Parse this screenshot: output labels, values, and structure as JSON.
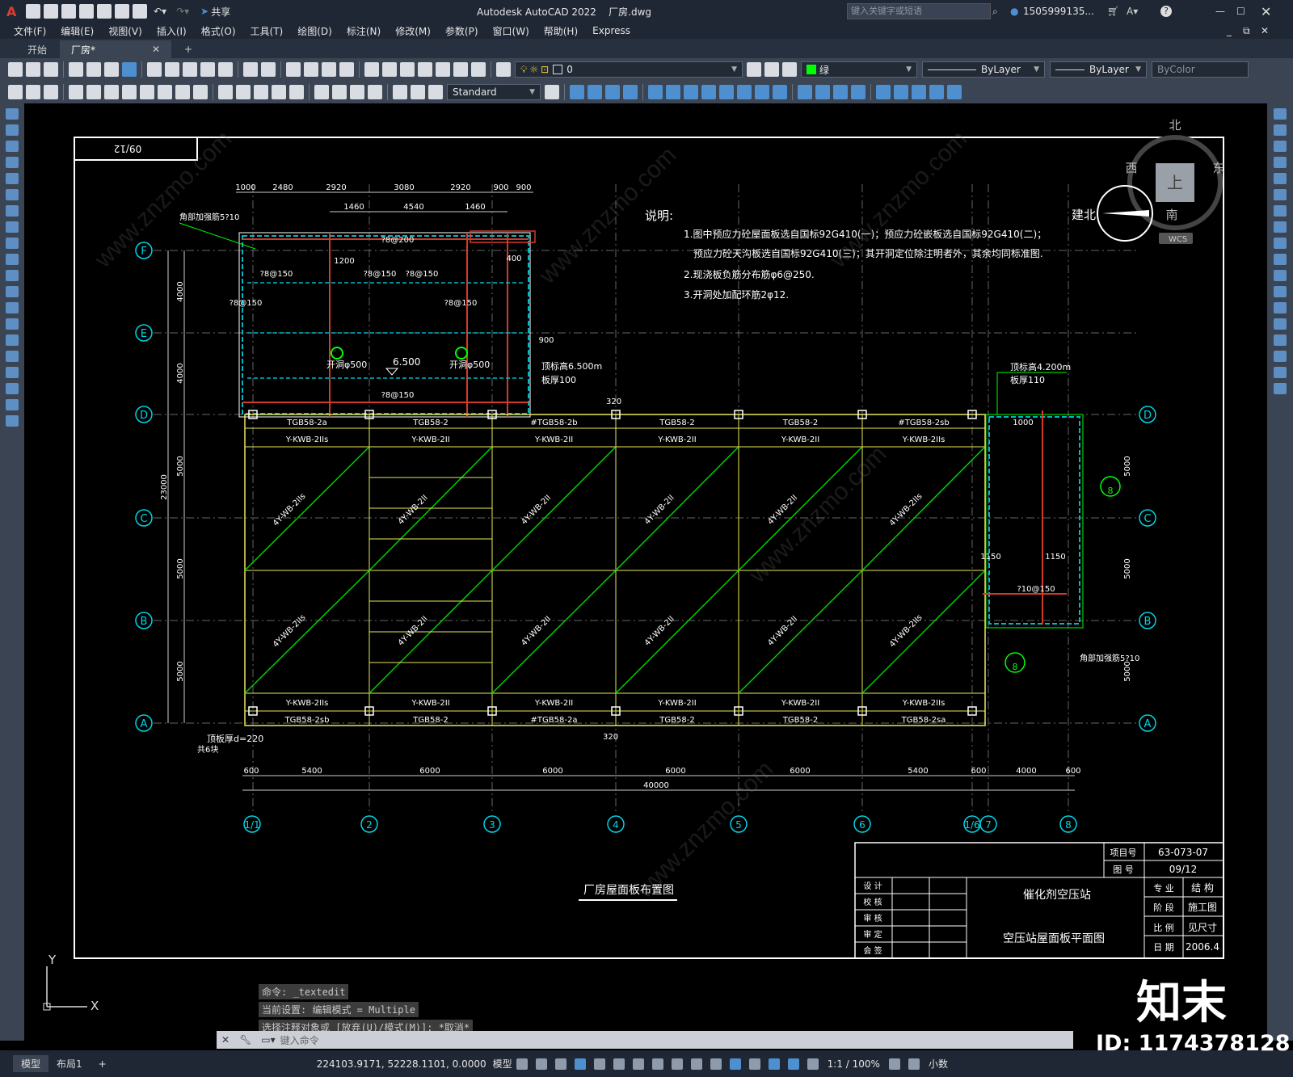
{
  "app": {
    "title": "Autodesk AutoCAD 2022    厂房.dwg",
    "share_label": "共享",
    "search_placeholder": "键入关键字或短语",
    "user": "1505999135...",
    "logo_letter": "A"
  },
  "menu": [
    "文件(F)",
    "编辑(E)",
    "视图(V)",
    "插入(I)",
    "格式(O)",
    "工具(T)",
    "绘图(D)",
    "标注(N)",
    "修改(M)",
    "参数(P)",
    "窗口(W)",
    "帮助(H)",
    "Express"
  ],
  "doc_tabs": [
    {
      "label": "开始",
      "active": false
    },
    {
      "label": "厂房*",
      "active": true
    }
  ],
  "toolbar": {
    "layer_value": "0",
    "color_value": "绿",
    "linetype_value": "ByLayer",
    "lineweight_value": "ByLayer",
    "plotstyle_value": "ByColor",
    "textstyle_value": "Standard"
  },
  "drawing": {
    "sheet_no": "09/12",
    "notes_title": "说明:",
    "notes": [
      "1.图中预应力砼屋面板选自国标92G410(一)；预应力砼嵌板选自国标92G410(二)；",
      "预应力砼天沟板选自国标92G410(三)；其开洞定位除注明者外，其余均同标准图.",
      "2.现浇板负筋分布筋φ6@250.",
      "3.开洞处加配环筋2φ12."
    ],
    "top_dims": [
      "1000",
      "2480",
      "2920",
      "3080",
      "2920",
      "900",
      "900"
    ],
    "top_dims2": [
      "1460",
      "4540",
      "1460"
    ],
    "bottom_dims": [
      "600",
      "5400",
      "6000",
      "6000",
      "6000",
      "6000",
      "5400",
      "600",
      "4000",
      "600"
    ],
    "total_dim": "40000",
    "row_axes": [
      "F",
      "E",
      "D",
      "C",
      "B",
      "A"
    ],
    "col_axes": [
      "1/1",
      "2",
      "3",
      "4",
      "5",
      "6",
      "1/6",
      "7",
      "8"
    ],
    "left_dims": [
      "4000",
      "4000",
      "5000",
      "5000",
      "5000"
    ],
    "left_total": "23000",
    "right_dims": [
      "5000",
      "5000",
      "5000"
    ],
    "top_row_labels": [
      "TGB58-2a",
      "TGB58-2",
      "#TGB58-2b",
      "TGB58-2",
      "TGB58-2",
      "#TGB58-2sb"
    ],
    "kwb_top_labels": [
      "Y-KWB-2IIs",
      "Y-KWB-2II",
      "Y-KWB-2II",
      "Y-KWB-2II",
      "Y-KWB-2II",
      "Y-KWB-2IIs"
    ],
    "kwb_bottom_labels": [
      "Y-KWB-2IIs",
      "Y-KWB-2II",
      "Y-KWB-2II",
      "Y-KWB-2II",
      "Y-KWB-2II",
      "Y-KWB-2IIs"
    ],
    "bottom_row_labels": [
      "TGB58-2sb",
      "TGB58-2",
      "#TGB58-2a",
      "TGB58-2",
      "TGB58-2",
      "TGB58-2sa"
    ],
    "diag_labels_upper": [
      "4Y-WB-2IIs",
      "4Y-WB-2II",
      "4Y-WB-2II",
      "4Y-WB-2II",
      "4Y-WB-2II",
      "4Y-WB-2IIs"
    ],
    "diag_labels_lower": [
      "4Y-WB-2IIs",
      "4Y-WB-2II",
      "4Y-WB-2II",
      "4Y-WB-2II",
      "4Y-WB-2II",
      "4Y-WB-2IIs"
    ],
    "elev_1": "6.500",
    "elev_top": "顶标高6.500m",
    "slab_thk_1": "板厚100",
    "elev_right": "顶标高4.200m",
    "slab_thk_2": "板厚110",
    "hole_1": "开洞φ500",
    "hole_2": "开洞φ500",
    "corner_note_1": "角部加强筋5?10",
    "corner_note_2": "角部加强筋5?10",
    "left_note": "顶板厚d=220",
    "left_note2": "共6块",
    "dim_320_top": "320",
    "dim_320_bot": "320",
    "rebar_labels": [
      "?8@200",
      "?8@150",
      "?8@150",
      "?8@150",
      "?8@150",
      "?8@150",
      "?8@150",
      "?10@150"
    ],
    "small_dims": [
      "1200",
      "1150",
      "1150",
      "400",
      "900",
      "1000"
    ],
    "plan_title": "厂房屋面板布置图",
    "section_mark": "8"
  },
  "compass": {
    "north": "北",
    "south": "南",
    "east": "东",
    "west": "西",
    "top": "上",
    "wcs": "WCS",
    "arch_north": "建北"
  },
  "title_block": {
    "project_no_label": "项目号",
    "project_no": "63-073-07",
    "drawing_no_label": "图    号",
    "drawing_no": "09/12",
    "project_name": "催化剂空压站",
    "drawing_name": "空压站屋面板平面图",
    "sign_rows": [
      "设  计",
      "校  核",
      "审  核",
      "审  定",
      "会  签"
    ],
    "specialty_label": "专  业",
    "specialty": "结  构",
    "stage_label": "阶  段",
    "stage": "施工图",
    "scale_label": "比  例",
    "scale": "见尺寸",
    "date_label": "日  期",
    "date": "2006.4"
  },
  "command": {
    "history": [
      "命令: _textedit",
      "当前设置: 编辑模式 = Multiple",
      "选择注释对象或 [放弃(U)/模式(M)]: *取消*"
    ],
    "input_placeholder": "键入命令"
  },
  "ucs": {
    "x": "X",
    "y": "Y"
  },
  "status": {
    "layout_tabs": [
      "模型",
      "布局1"
    ],
    "coords": "224103.9171, 52228.1101, 0.0000",
    "mode": "模型",
    "scale": "1:1 / 100%",
    "units": "小数"
  },
  "watermark": {
    "brand": "知末",
    "id": "ID: 1174378128",
    "site": "www.znzmo.com"
  }
}
